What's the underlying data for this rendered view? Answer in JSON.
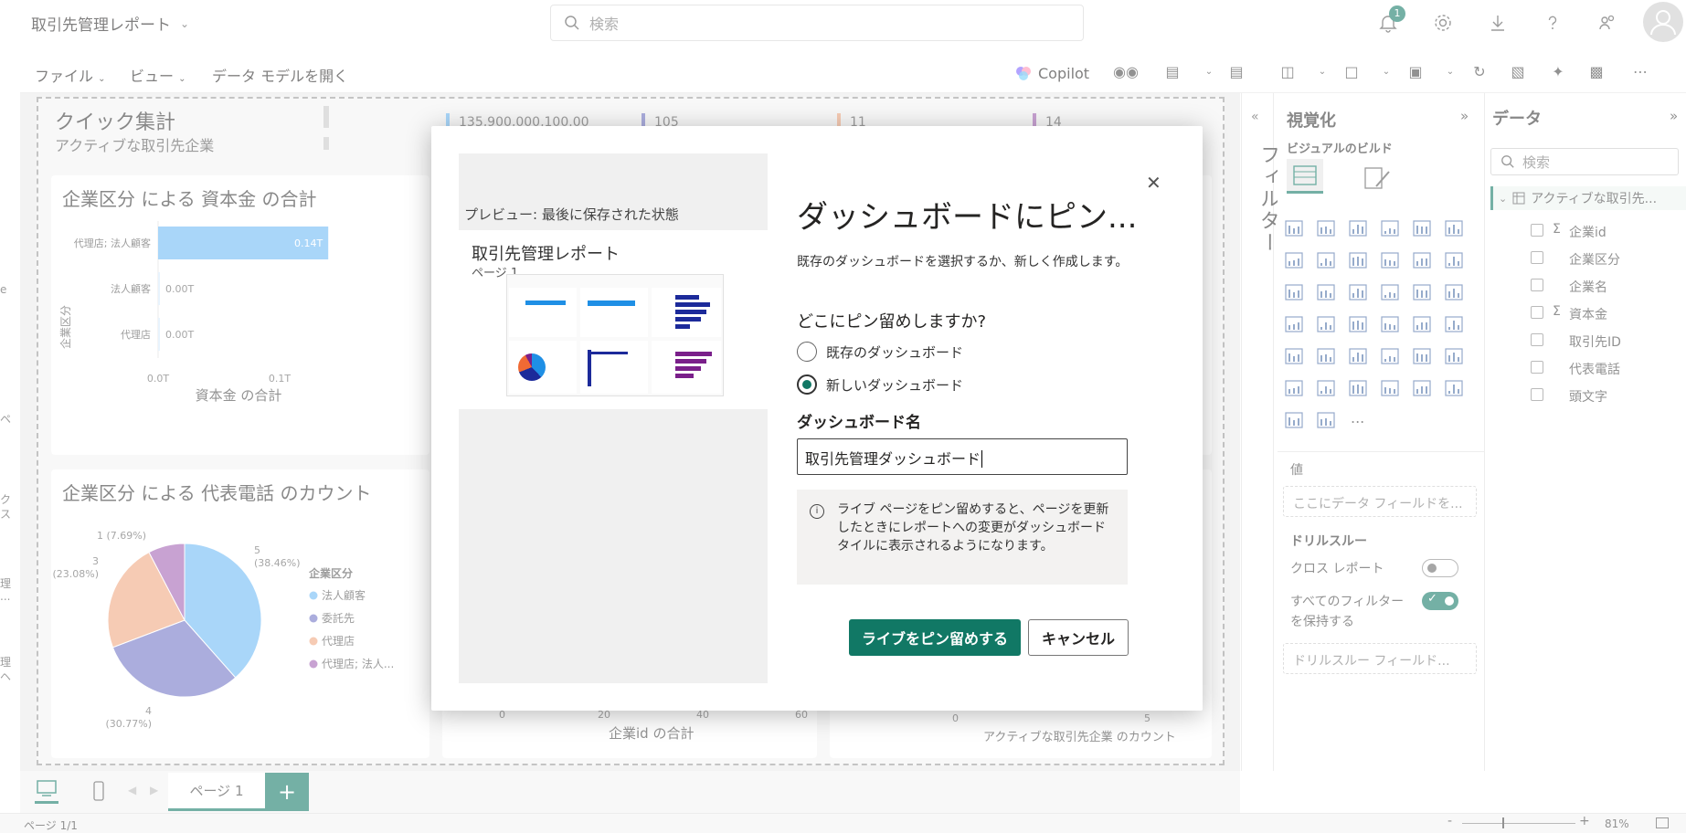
{
  "header": {
    "report_title": "取引先管理レポート",
    "search_placeholder": "検索",
    "notification_count": "1"
  },
  "ribbon": {
    "file": "ファイル",
    "view": "ビュー",
    "open_model": "データ モデルを開く",
    "copilot": "Copilot"
  },
  "canvas": {
    "quick_title": "クイック集計",
    "quick_subtitle": "アクティブな取引先企業",
    "kpi1": "135,900,000,100.00",
    "kpi2": "105",
    "kpi3": "11",
    "kpi4": "14",
    "bar_chart_title": "企業区分 による 資本金 の合計",
    "pie_chart_title": "企業区分 による 代表電話 のカウント",
    "bottom_axis_mid": "企業id の合計",
    "bottom_axis_right": "アクティブな取引先企業 のカウント",
    "axis_tick_0": "0",
    "axis_tick_20": "20",
    "axis_tick_40": "40",
    "axis_tick_60": "60",
    "axis_tick_r0": "0",
    "axis_tick_r5": "5"
  },
  "chart_data": [
    {
      "type": "bar",
      "title": "企業区分 による 資本金 の合計",
      "categories": [
        "代理店; 法人顧客",
        "法人顧客",
        "代理店"
      ],
      "values": [
        0.14,
        0.0,
        0.0
      ],
      "value_labels": [
        "0.14T",
        "0.00T",
        "0.00T"
      ],
      "xlabel": "資本金 の合計",
      "ylabel": "企業区分",
      "xticks": [
        "0.0T",
        "0.1T"
      ],
      "xlim": [
        0,
        0.15
      ]
    },
    {
      "type": "pie",
      "title": "企業区分 による 代表電話 のカウント",
      "legend_title": "企業区分",
      "categories": [
        "法人顧客",
        "委託先",
        "代理店",
        "代理店; 法人..."
      ],
      "values": [
        5,
        4,
        3,
        1
      ],
      "labels": [
        "5\n(38.46%)",
        "4\n(30.77%)",
        "3\n(23.08%)",
        "1 (7.69%)"
      ],
      "colors": [
        "#6cb8f5",
        "#6e72c4",
        "#efa57f",
        "#a05fb2"
      ],
      "legend": "right"
    }
  ],
  "modal": {
    "preview_caption": "プレビュー: 最後に保存された状態",
    "preview_report_title": "取引先管理レポート",
    "preview_page": "ページ 1",
    "title": "ダッシュボードにピン...",
    "description": "既存のダッシュボードを選択するか、新しく作成します。",
    "where_label": "どこにピン留めしますか?",
    "option_existing": "既存のダッシュボード",
    "option_new": "新しいダッシュボード",
    "selected_option": "新しいダッシュボード",
    "name_label": "ダッシュボード名",
    "name_value": "取引先管理ダッシュボード",
    "info_text": "ライブ ページをピン留めすると、ページを更新したときにレポートへの変更がダッシュボード タイルに表示されるようになります。",
    "primary_button": "ライブをピン留めする",
    "cancel_button": "キャンセル",
    "accent": "#117865"
  },
  "filters_pane": {
    "label": "フィルター"
  },
  "visual_pane": {
    "title": "視覚化",
    "build_label": "ビジュアルのビルド",
    "values_label": "値",
    "values_placeholder": "ここにデータ フィールドを...",
    "drill_label": "ドリルスルー",
    "cross_report": "クロス レポート",
    "keep_filters": "すべてのフィルターを保持する",
    "cross_report_on": false,
    "keep_filters_on": true,
    "drill_placeholder": "ドリルスルー フィールド...",
    "more": "..."
  },
  "data_pane": {
    "title": "データ",
    "search_placeholder": "検索",
    "table_name": "アクティブな取引先...",
    "fields": [
      {
        "name": "企業id",
        "sigma": true
      },
      {
        "name": "企業区分",
        "sigma": false
      },
      {
        "name": "企業名",
        "sigma": false
      },
      {
        "name": "資本金",
        "sigma": true
      },
      {
        "name": "取引先ID",
        "sigma": false
      },
      {
        "name": "代表電話",
        "sigma": false
      },
      {
        "name": "頭文字",
        "sigma": false
      }
    ]
  },
  "pages": {
    "tab_label": "ページ 1",
    "add": "+",
    "page_count": "ページ 1/1",
    "zoom": "81%"
  },
  "left_edge_text": [
    "e",
    "ペ",
    "ク",
    "ス",
    "理",
    "...",
    "理",
    "ヘ"
  ]
}
